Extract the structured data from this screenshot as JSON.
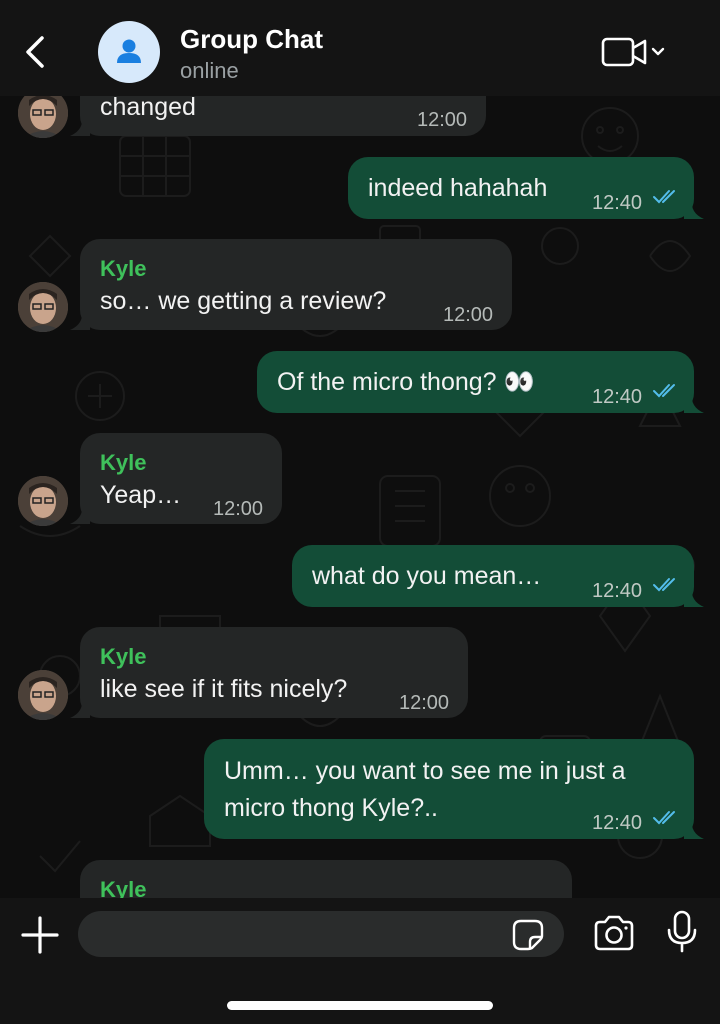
{
  "header": {
    "title": "Group Chat",
    "status": "online",
    "back_icon": "chevron-left-icon",
    "video_icon": "video-camera-icon"
  },
  "messages": [
    {
      "direction": "incoming",
      "sender": "",
      "text": "changed",
      "time": "12:00"
    },
    {
      "direction": "outgoing",
      "text": "indeed hahahah",
      "time": "12:40",
      "status": "read"
    },
    {
      "direction": "incoming",
      "sender": "Kyle",
      "text": "so… we getting a review?",
      "time": "12:00"
    },
    {
      "direction": "outgoing",
      "text": "Of the micro thong? 👀",
      "time": "12:40",
      "status": "read"
    },
    {
      "direction": "incoming",
      "sender": "Kyle",
      "text": "Yeap…",
      "time": "12:00"
    },
    {
      "direction": "outgoing",
      "text": "what do you mean…",
      "time": "12:40",
      "status": "read"
    },
    {
      "direction": "incoming",
      "sender": "Kyle",
      "text": "like see if it fits nicely?",
      "time": "12:00"
    },
    {
      "direction": "outgoing",
      "text_lines": [
        "Umm… you want to see me in just a",
        "micro thong Kyle?.."
      ],
      "time": "12:40",
      "status": "read"
    },
    {
      "direction": "incoming",
      "sender": "Kyle",
      "text": "",
      "time": ""
    }
  ],
  "composer": {
    "placeholder": "",
    "plus_icon": "plus-icon",
    "sticker_icon": "sticker-icon",
    "camera_icon": "camera-icon",
    "mic_icon": "microphone-icon"
  },
  "colors": {
    "incoming_bubble": "#242626",
    "outgoing_bubble": "#134d37",
    "sender_name": "#3fc15b",
    "read_ticks": "#53bdeb"
  }
}
